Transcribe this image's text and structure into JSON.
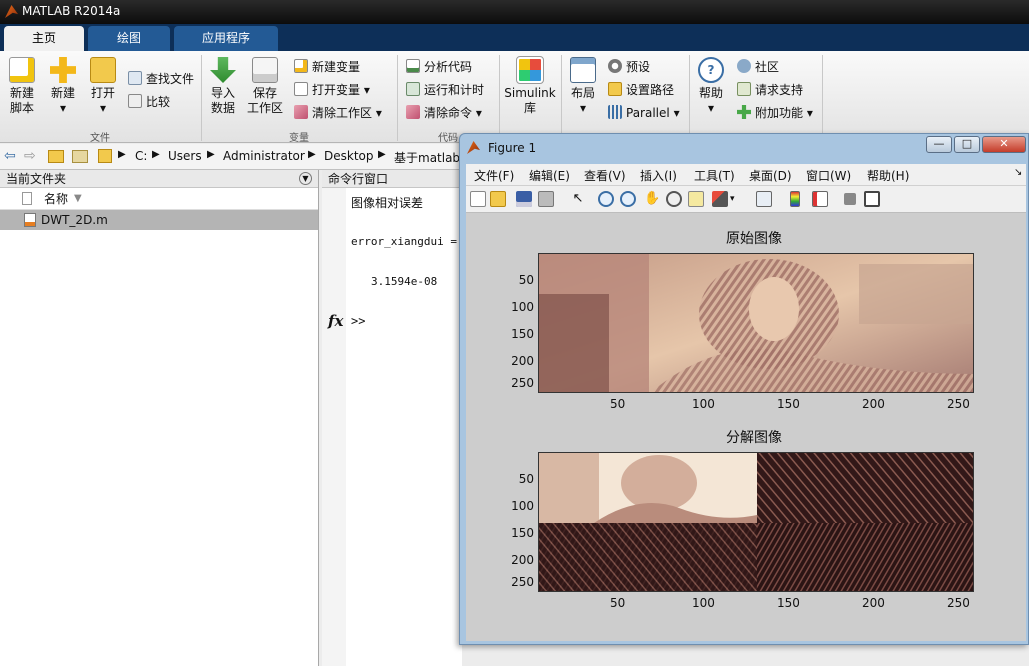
{
  "window": {
    "title": "MATLAB R2014a"
  },
  "tabs": [
    "主页",
    "绘图",
    "应用程序"
  ],
  "ribbon": {
    "new_script": "新建\n脚本",
    "new": "新建",
    "open": "打开",
    "find_files": "查找文件",
    "compare": "比较",
    "import_data": "导入\n数据",
    "save_workspace": "保存\n工作区",
    "new_variable": "新建变量",
    "open_variable": "打开变量",
    "clear_workspace": "清除工作区",
    "analyze_code": "分析代码",
    "run_and_time": "运行和计时",
    "clear_commands": "清除命令",
    "simulink": "Simulink\n库",
    "layout": "布局",
    "preferences": "预设",
    "set_path": "设置路径",
    "parallel": "Parallel",
    "help": "帮助",
    "community": "社区",
    "request_support": "请求支持",
    "addons": "附加功能",
    "group_file": "文件",
    "group_variable": "变量",
    "group_code": "代码"
  },
  "address": {
    "segments": [
      "C:",
      "Users",
      "Administrator",
      "Desktop",
      "基于matlab"
    ]
  },
  "current_folder": {
    "title": "当前文件夹",
    "col_name": "名称",
    "files": [
      "DWT_2D.m"
    ]
  },
  "command_window": {
    "title": "命令行窗口",
    "lines": [
      "图像相对误差",
      "error_xiangdui =",
      "3.1594e-08"
    ],
    "prompt": ">>",
    "fx": "fx"
  },
  "figure": {
    "title": "Figure 1",
    "menu": [
      "文件(F)",
      "编辑(E)",
      "查看(V)",
      "插入(I)",
      "工具(T)",
      "桌面(D)",
      "窗口(W)",
      "帮助(H)"
    ],
    "toolbar_icons": [
      "new-figure-icon",
      "open-file-icon",
      "save-icon",
      "print-icon",
      "pointer-icon",
      "zoom-in-icon",
      "zoom-out-icon",
      "pan-icon",
      "rotate-icon",
      "data-cursor-icon",
      "brush-icon",
      "link-icon",
      "colorbar-icon",
      "legend-icon",
      "hide-plot-tools-icon",
      "show-plot-tools-icon"
    ],
    "axes": [
      {
        "title": "原始图像",
        "yticks": [
          "50",
          "100",
          "150",
          "200",
          "250"
        ],
        "xticks": [
          "50",
          "100",
          "150",
          "200",
          "250"
        ]
      },
      {
        "title": "分解图像",
        "yticks": [
          "50",
          "100",
          "150",
          "200",
          "250"
        ],
        "xticks": [
          "50",
          "100",
          "150",
          "200",
          "250"
        ]
      }
    ]
  },
  "colors": {
    "ribbon_tab_bar": "#0d2f58",
    "figure_frame": "#a8c5e0",
    "pink_colormap_light": "#f4e6d6",
    "pink_colormap_dark": "#2b1414"
  }
}
